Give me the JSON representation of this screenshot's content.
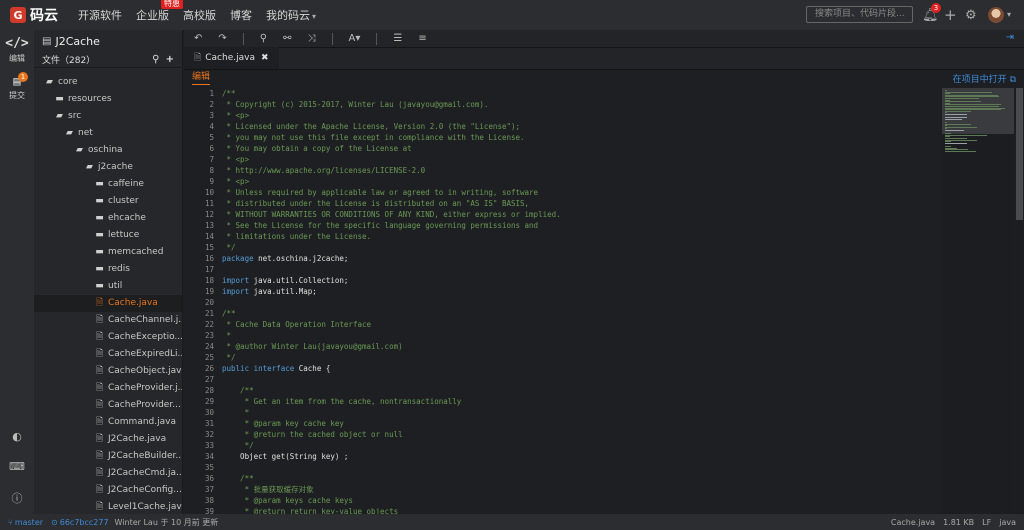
{
  "brand": {
    "logo_glyph": "G",
    "name": "码云"
  },
  "topnav": [
    {
      "label": "开源软件"
    },
    {
      "label": "企业版",
      "badge": "特惠"
    },
    {
      "label": "高校版"
    },
    {
      "label": "博客"
    },
    {
      "label": "我的码云",
      "has_caret": true
    }
  ],
  "search": {
    "placeholder": "搜索项目、代码片段..."
  },
  "notifications": {
    "count": "3"
  },
  "activity_bar": {
    "edit_label": "编辑",
    "commit_label": "提交",
    "commit_badge": "1"
  },
  "sidebar": {
    "repo_name": "J2Cache",
    "files_label": "文件（282）",
    "tree": [
      {
        "name": "core",
        "type": "folder-open",
        "depth": 0
      },
      {
        "name": "resources",
        "type": "folder",
        "depth": 1
      },
      {
        "name": "src",
        "type": "folder-open",
        "depth": 1
      },
      {
        "name": "net",
        "type": "folder-open",
        "depth": 2
      },
      {
        "name": "oschina",
        "type": "folder-open",
        "depth": 3
      },
      {
        "name": "j2cache",
        "type": "folder-open",
        "depth": 4
      },
      {
        "name": "caffeine",
        "type": "folder",
        "depth": 5
      },
      {
        "name": "cluster",
        "type": "folder",
        "depth": 5
      },
      {
        "name": "ehcache",
        "type": "folder",
        "depth": 5
      },
      {
        "name": "lettuce",
        "type": "folder",
        "depth": 5
      },
      {
        "name": "memcached",
        "type": "folder",
        "depth": 5
      },
      {
        "name": "redis",
        "type": "folder",
        "depth": 5
      },
      {
        "name": "util",
        "type": "folder",
        "depth": 5
      },
      {
        "name": "Cache.java",
        "type": "file",
        "depth": 5,
        "active": true
      },
      {
        "name": "CacheChannel.j...",
        "type": "file",
        "depth": 5
      },
      {
        "name": "CacheExceptio...",
        "type": "file",
        "depth": 5
      },
      {
        "name": "CacheExpiredLi...",
        "type": "file",
        "depth": 5
      },
      {
        "name": "CacheObject.java",
        "type": "file",
        "depth": 5
      },
      {
        "name": "CacheProvider.j...",
        "type": "file",
        "depth": 5
      },
      {
        "name": "CacheProvider...",
        "type": "file",
        "depth": 5
      },
      {
        "name": "Command.java",
        "type": "file",
        "depth": 5
      },
      {
        "name": "J2Cache.java",
        "type": "file",
        "depth": 5
      },
      {
        "name": "J2CacheBuilder...",
        "type": "file",
        "depth": 5
      },
      {
        "name": "J2CacheCmd.ja...",
        "type": "file",
        "depth": 5
      },
      {
        "name": "J2CacheConfig...",
        "type": "file",
        "depth": 5
      },
      {
        "name": "Level1Cache.java",
        "type": "file",
        "depth": 5
      },
      {
        "name": "Level2Cache.java",
        "type": "file",
        "depth": 5
      }
    ]
  },
  "editor": {
    "tab_label": "Cache.java",
    "mode_label": "编辑",
    "open_in_project": "在项目中打开",
    "lines": [
      {
        "n": "1",
        "t": "/**",
        "k": "c"
      },
      {
        "n": "2",
        "t": " * Copyright (c) 2015-2017, Winter Lau (javayou@gmail.com).",
        "k": "c"
      },
      {
        "n": "3",
        "t": " * <p>",
        "k": "c"
      },
      {
        "n": "4",
        "t": " * Licensed under the Apache License, Version 2.0 (the \"License\");",
        "k": "c"
      },
      {
        "n": "5",
        "t": " * you may not use this file except in compliance with the License.",
        "k": "c"
      },
      {
        "n": "6",
        "t": " * You may obtain a copy of the License at",
        "k": "c"
      },
      {
        "n": "7",
        "t": " * <p>",
        "k": "c"
      },
      {
        "n": "8",
        "t": " * http://www.apache.org/licenses/LICENSE-2.0",
        "k": "c"
      },
      {
        "n": "9",
        "t": " * <p>",
        "k": "c"
      },
      {
        "n": "10",
        "t": " * Unless required by applicable law or agreed to in writing, software",
        "k": "c"
      },
      {
        "n": "11",
        "t": " * distributed under the License is distributed on an \"AS IS\" BASIS,",
        "k": "c"
      },
      {
        "n": "12",
        "t": " * WITHOUT WARRANTIES OR CONDITIONS OF ANY KIND, either express or implied.",
        "k": "c"
      },
      {
        "n": "13",
        "t": " * See the License for the specific language governing permissions and",
        "k": "c"
      },
      {
        "n": "14",
        "t": " * limitations under the License.",
        "k": "c"
      },
      {
        "n": "15",
        "t": " */",
        "k": "c"
      },
      {
        "n": "16",
        "t": "package net.oschina.j2cache;",
        "k": "p"
      },
      {
        "n": "17",
        "t": "",
        "k": "p"
      },
      {
        "n": "18",
        "t": "import java.util.Collection;",
        "k": "p"
      },
      {
        "n": "19",
        "t": "import java.util.Map;",
        "k": "p"
      },
      {
        "n": "20",
        "t": "",
        "k": "p"
      },
      {
        "n": "21",
        "t": "/**",
        "k": "c"
      },
      {
        "n": "22",
        "t": " * Cache Data Operation Interface",
        "k": "c"
      },
      {
        "n": "23",
        "t": " *",
        "k": "c"
      },
      {
        "n": "24",
        "t": " * @author Winter Lau(javayou@gmail.com)",
        "k": "c"
      },
      {
        "n": "25",
        "t": " */",
        "k": "c"
      },
      {
        "n": "26",
        "t": "public interface Cache {",
        "k": "p"
      },
      {
        "n": "27",
        "t": "",
        "k": "p"
      },
      {
        "n": "28",
        "t": "    /**",
        "k": "c"
      },
      {
        "n": "29",
        "t": "     * Get an item from the cache, nontransactionally",
        "k": "c"
      },
      {
        "n": "30",
        "t": "     *",
        "k": "c"
      },
      {
        "n": "31",
        "t": "     * @param key cache key",
        "k": "c"
      },
      {
        "n": "32",
        "t": "     * @return the cached object or null",
        "k": "c"
      },
      {
        "n": "33",
        "t": "     */",
        "k": "c"
      },
      {
        "n": "34",
        "t": "    Object get(String key) ;",
        "k": "p"
      },
      {
        "n": "35",
        "t": "",
        "k": "p"
      },
      {
        "n": "36",
        "t": "    /**",
        "k": "c"
      },
      {
        "n": "37",
        "t": "     * 批量获取缓存对象",
        "k": "c"
      },
      {
        "n": "38",
        "t": "     * @param keys cache keys",
        "k": "c"
      },
      {
        "n": "39",
        "t": "     * @return return key-value objects",
        "k": "c"
      }
    ]
  },
  "statusbar": {
    "branch": "master",
    "commit": "66c7bcc277",
    "commit_info": "Winter Lau 于 10 月前 更新",
    "file_name": "Cache.java",
    "file_size": "1.81 KB",
    "line_ending": "LF",
    "language": "java"
  }
}
